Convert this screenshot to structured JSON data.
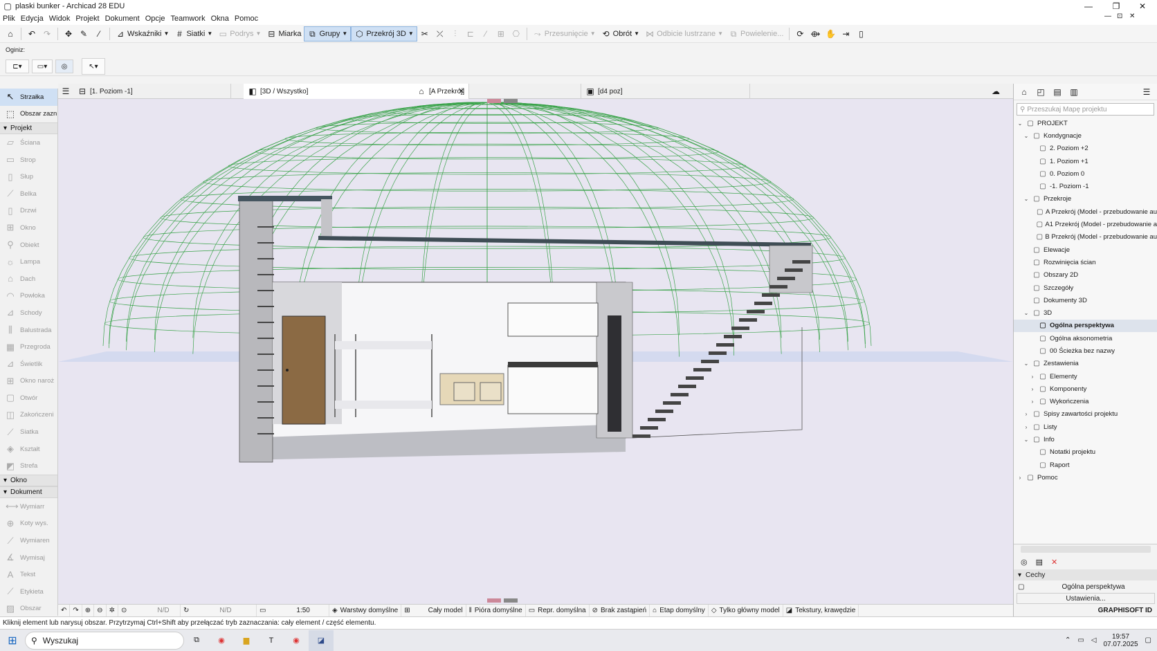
{
  "titlebar": {
    "title": "plaski bunker - Archicad 28 EDU",
    "min": "—",
    "max": "❐",
    "close": "✕",
    "extra1": "—",
    "extra2": "⊡",
    "extra3": "✕"
  },
  "menu": [
    "Plik",
    "Edycja",
    "Widok",
    "Projekt",
    "Dokument",
    "Opcje",
    "Teamwork",
    "Okna",
    "Pomoc"
  ],
  "toolbar": {
    "wskazniki": "Wskaźniki",
    "siatki": "Siatki",
    "podrys": "Podrys",
    "miarka": "Miarka",
    "grupy": "Grupy",
    "przekroj3d": "Przekrój 3D",
    "przesuniecie": "Przesunięcie",
    "obrot": "Obrót",
    "odbicie": "Odbicie lustrzane",
    "powielenie": "Powielenie..."
  },
  "infobox": {
    "label": "Oginiz:"
  },
  "toolbox": {
    "selection": [
      {
        "label": "Strzałka",
        "icon": "arrow-icon",
        "selected": true
      },
      {
        "label": "Obszar zazn",
        "icon": "marquee-icon",
        "selected": false
      }
    ],
    "projekt_header": "Projekt",
    "projekt": [
      {
        "label": "Ściana",
        "icon": "wall-icon"
      },
      {
        "label": "Strop",
        "icon": "slab-icon"
      },
      {
        "label": "Słup",
        "icon": "column-icon"
      },
      {
        "label": "Belka",
        "icon": "beam-icon"
      },
      {
        "label": "Drzwi",
        "icon": "door-icon"
      },
      {
        "label": "Okno",
        "icon": "window-icon"
      },
      {
        "label": "Obiekt",
        "icon": "object-icon"
      },
      {
        "label": "Lampa",
        "icon": "lamp-icon"
      },
      {
        "label": "Dach",
        "icon": "roof-icon"
      },
      {
        "label": "Powłoka",
        "icon": "shell-icon"
      },
      {
        "label": "Schody",
        "icon": "stair-icon"
      },
      {
        "label": "Balustrada",
        "icon": "railing-icon"
      },
      {
        "label": "Przegroda",
        "icon": "curtain-wall-icon"
      },
      {
        "label": "Świetlik",
        "icon": "skylight-icon"
      },
      {
        "label": "Okno naroż",
        "icon": "corner-window-icon"
      },
      {
        "label": "Otwór",
        "icon": "opening-icon"
      },
      {
        "label": "Zakończeni",
        "icon": "end-icon"
      },
      {
        "label": "Siatka",
        "icon": "mesh-icon"
      },
      {
        "label": "Kształt",
        "icon": "morph-icon"
      },
      {
        "label": "Strefa",
        "icon": "zone-icon"
      }
    ],
    "okno_header": "Okno",
    "dokument_header": "Dokument",
    "dokument": [
      {
        "label": "Wymiarr",
        "icon": "dimension-icon"
      },
      {
        "label": "Koty wys.",
        "icon": "level-dim-icon"
      },
      {
        "label": "Wymiaren",
        "icon": "radial-dim-icon"
      },
      {
        "label": "Wymisaj",
        "icon": "angle-dim-icon"
      },
      {
        "label": "Tekst",
        "icon": "text-icon"
      },
      {
        "label": "Etykieta",
        "icon": "label-icon"
      },
      {
        "label": "Obszar",
        "icon": "fill-icon"
      }
    ]
  },
  "tabs": [
    {
      "label": "[1. Poziom -1]",
      "icon": "floorplan-icon"
    },
    {
      "label": "[3D / Wszystko]",
      "icon": "3d-icon",
      "active": true,
      "close": "✕"
    },
    {
      "label": "[A Przekrój]",
      "icon": "section-icon"
    },
    {
      "label": "[d4 poz]",
      "icon": "layout-icon"
    }
  ],
  "statusrow": {
    "nd1": "N/D",
    "nd2": "N/D",
    "scale": "1:50",
    "layers": "Warstwy domyślne",
    "model": "Cały model",
    "pens": "Pióra domyślne",
    "repr": "Repr. domyślna",
    "override": "Brak zastąpień",
    "phase": "Etap domyślny",
    "main": "Tylko główny model",
    "textures": "Tekstury, krawędzie"
  },
  "message": "Kliknij element lub narysuj obszar. Przytrzymaj Ctrl+Shift aby przełączać tryb zaznaczania: cały element / część elementu.",
  "navigator": {
    "search_placeholder": "Przeszukaj Mapę projektu",
    "tree": [
      {
        "label": "PROJEKT",
        "depth": 0,
        "toggle": "⌄",
        "icon": "project-icon"
      },
      {
        "label": "Kondygnacje",
        "depth": 1,
        "toggle": "⌄",
        "icon": "stories-icon"
      },
      {
        "label": "2. Poziom +2",
        "depth": 2,
        "toggle": "",
        "icon": "story-icon"
      },
      {
        "label": "1. Poziom +1",
        "depth": 2,
        "toggle": "",
        "icon": "story-icon"
      },
      {
        "label": "0. Poziom 0",
        "depth": 2,
        "toggle": "",
        "icon": "story-icon"
      },
      {
        "label": "-1. Poziom -1",
        "depth": 2,
        "toggle": "",
        "icon": "story-icon"
      },
      {
        "label": "Przekroje",
        "depth": 1,
        "toggle": "⌄",
        "icon": "sections-icon"
      },
      {
        "label": "A Przekrój (Model - przebudowanie au",
        "depth": 2,
        "toggle": "",
        "icon": "section-icon"
      },
      {
        "label": "A1 Przekrój (Model - przebudowanie a",
        "depth": 2,
        "toggle": "",
        "icon": "section-icon"
      },
      {
        "label": "B Przekrój (Model - przebudowanie au",
        "depth": 2,
        "toggle": "",
        "icon": "section-icon"
      },
      {
        "label": "Elewacje",
        "depth": 1,
        "toggle": "",
        "icon": "elevation-icon"
      },
      {
        "label": "Rozwinięcia ścian",
        "depth": 1,
        "toggle": "",
        "icon": "interior-elev-icon"
      },
      {
        "label": "Obszary 2D",
        "depth": 1,
        "toggle": "",
        "icon": "worksheet-icon"
      },
      {
        "label": "Szczegóły",
        "depth": 1,
        "toggle": "",
        "icon": "detail-icon"
      },
      {
        "label": "Dokumenty 3D",
        "depth": 1,
        "toggle": "",
        "icon": "3d-doc-icon"
      },
      {
        "label": "3D",
        "depth": 1,
        "toggle": "⌄",
        "icon": "3d-icon"
      },
      {
        "label": "Ogólna perspektywa",
        "depth": 2,
        "toggle": "",
        "icon": "perspective-icon",
        "selected": true
      },
      {
        "label": "Ogólna aksonometria",
        "depth": 2,
        "toggle": "",
        "icon": "axon-icon"
      },
      {
        "label": "00 Ścieżka bez nazwy",
        "depth": 2,
        "toggle": "",
        "icon": "path-icon"
      },
      {
        "label": "Zestawienia",
        "depth": 1,
        "toggle": "⌄",
        "icon": "schedule-icon"
      },
      {
        "label": "Elementy",
        "depth": 2,
        "toggle": "›",
        "icon": "list-icon"
      },
      {
        "label": "Komponenty",
        "depth": 2,
        "toggle": "›",
        "icon": "component-icon"
      },
      {
        "label": "Wykończenia",
        "depth": 2,
        "toggle": "›",
        "icon": "finish-icon"
      },
      {
        "label": "Spisy zawartości projektu",
        "depth": 1,
        "toggle": "›",
        "icon": "index-icon"
      },
      {
        "label": "Listy",
        "depth": 1,
        "toggle": "›",
        "icon": "lists-icon"
      },
      {
        "label": "Info",
        "depth": 1,
        "toggle": "⌄",
        "icon": "info-icon"
      },
      {
        "label": "Notatki projektu",
        "depth": 2,
        "toggle": "",
        "icon": "notes-icon"
      },
      {
        "label": "Raport",
        "depth": 2,
        "toggle": "",
        "icon": "report-icon"
      },
      {
        "label": "Pomoc",
        "depth": 0,
        "toggle": "›",
        "icon": "help-icon"
      }
    ],
    "props_header": "Cechy",
    "view_name": "Ogólna perspektywa",
    "settings": "Ustawienia...",
    "brand": "GRAPHISOFT ID"
  },
  "taskbar": {
    "search": "Wyszukaj",
    "time": "19:57",
    "date": "07.07.2025"
  }
}
